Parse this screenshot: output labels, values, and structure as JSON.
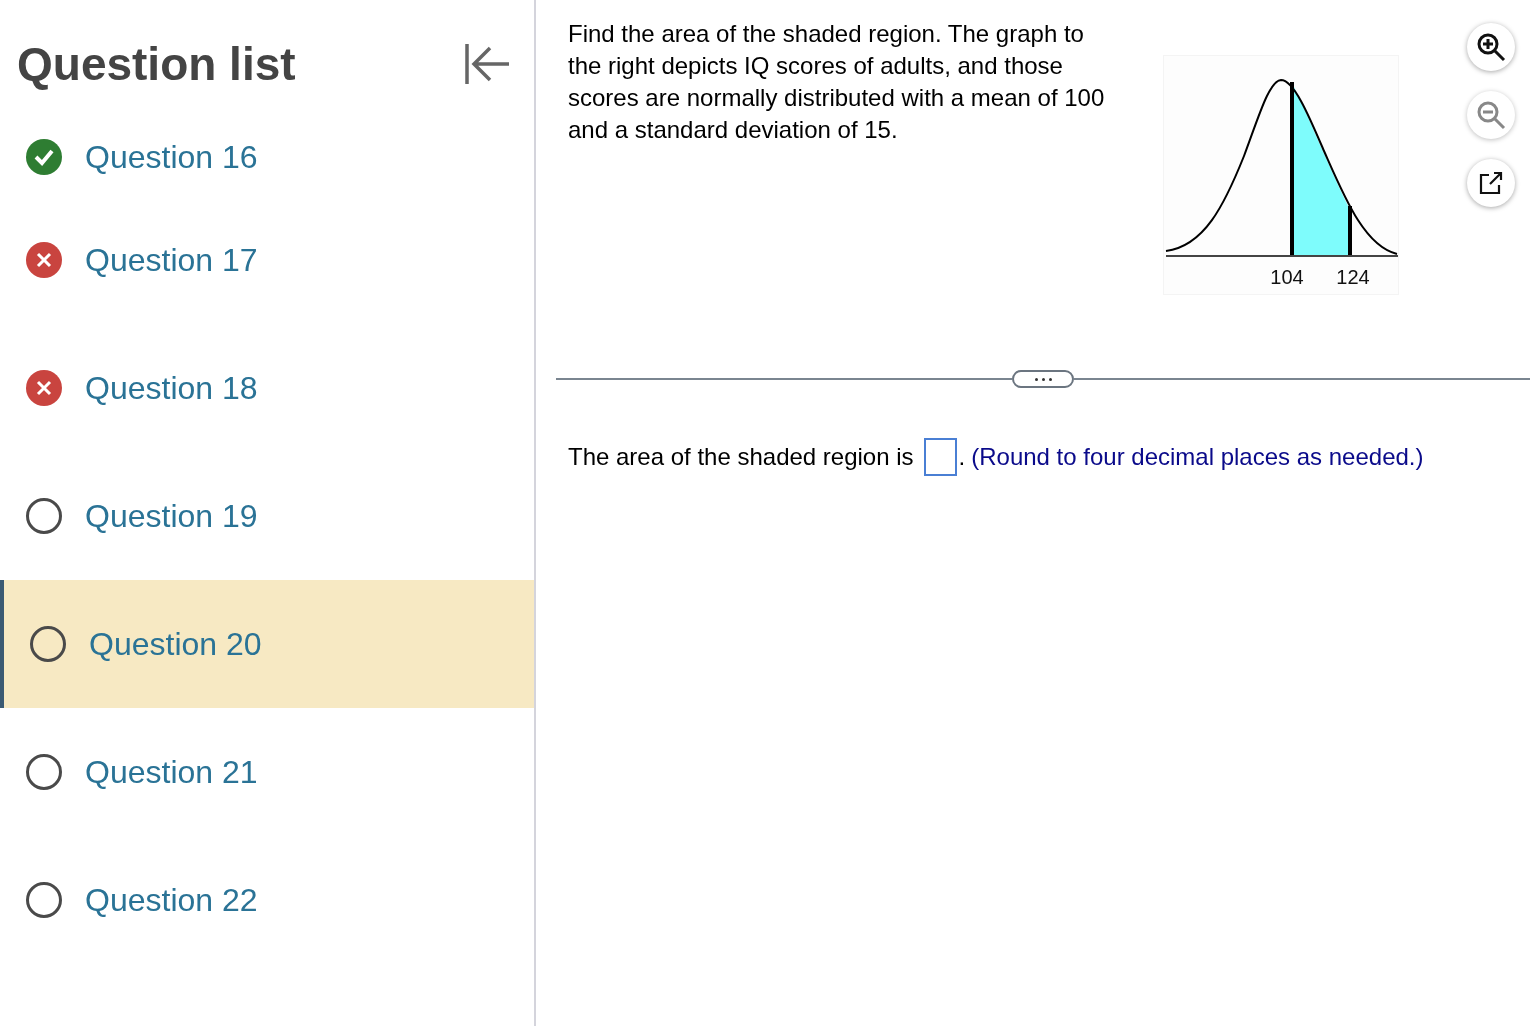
{
  "sidebar": {
    "title": "Question list",
    "items": [
      {
        "label": "Question 16",
        "kind": "correct",
        "selected": false
      },
      {
        "label": "Question 17",
        "kind": "incorrect",
        "selected": false
      },
      {
        "label": "Question 18",
        "kind": "incorrect",
        "selected": false
      },
      {
        "label": "Question 19",
        "kind": "unanswered",
        "selected": false
      },
      {
        "label": "Question 20",
        "kind": "unanswered",
        "selected": true
      },
      {
        "label": "Question 21",
        "kind": "unanswered",
        "selected": false
      },
      {
        "label": "Question 22",
        "kind": "unanswered",
        "selected": false
      }
    ]
  },
  "question": {
    "text": "Find the area of the shaded region. The graph to the right depicts IQ scores of adults, and those scores are normally distributed with a mean of 100 and a standard deviation of 15.",
    "graph": {
      "labels": [
        "104",
        "124"
      ]
    }
  },
  "answer": {
    "prefix": "The area of the shaded region is",
    "suffix": ".",
    "hint": "(Round to four decimal places as needed.)"
  }
}
